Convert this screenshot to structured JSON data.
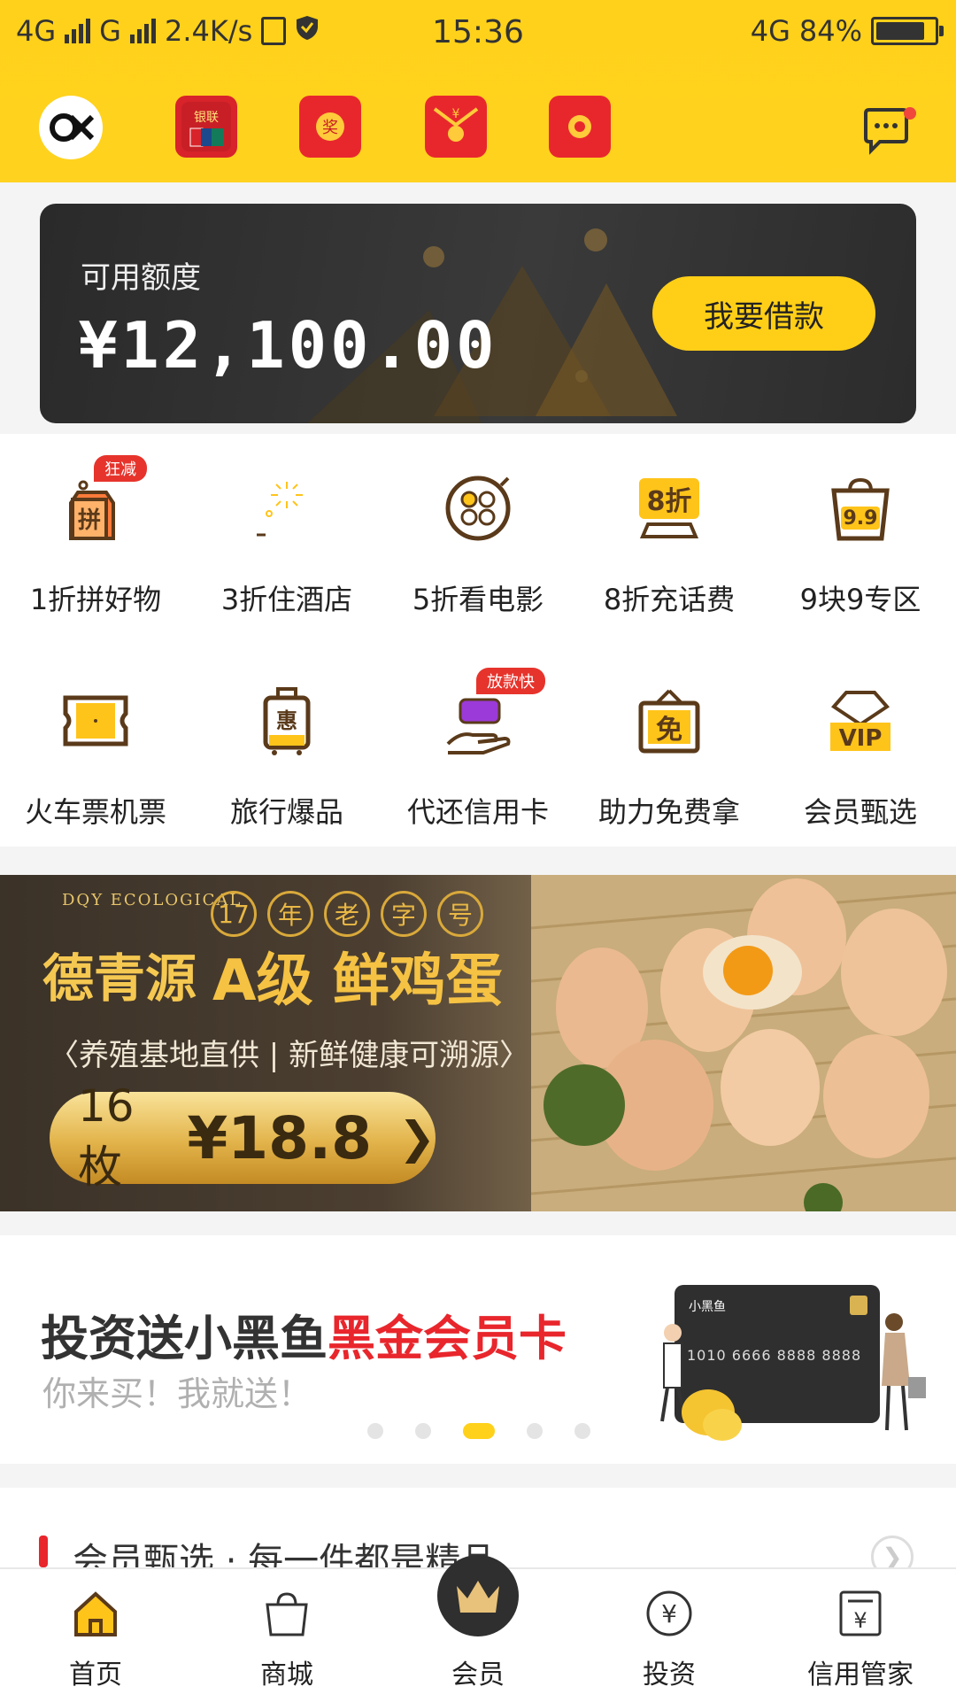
{
  "status_bar": {
    "network_left": "4G",
    "network_g": "G",
    "speed": "2.4K/s",
    "time": "15:36",
    "network_right": "4G",
    "battery": "84%",
    "battery_level": 0.84
  },
  "header": {
    "logo": "fish-logo-icon",
    "quick_icons": [
      "unionpay-icon",
      "prize-redpacket-icon",
      "yuan-redpacket-icon",
      "gift-redpacket-icon"
    ],
    "message_icon": "chat-bubble-icon",
    "has_unread": true
  },
  "credit": {
    "label": "可用额度",
    "amount": "¥12,100.00",
    "button": "我要借款"
  },
  "grid": [
    {
      "label": "1折拼好物",
      "icon": "pin-tag-icon",
      "tag": "狂减"
    },
    {
      "label": "3折住酒店",
      "icon": "hotel-icon",
      "tag": ""
    },
    {
      "label": "5折看电影",
      "icon": "film-reel-icon",
      "tag": ""
    },
    {
      "label": "8折充话费",
      "icon": "phone-discount-icon",
      "tag": ""
    },
    {
      "label": "9块9专区",
      "icon": "shopping-bag-icon",
      "tag": ""
    },
    {
      "label": "火车票机票",
      "icon": "ticket-icon",
      "tag": ""
    },
    {
      "label": "旅行爆品",
      "icon": "suitcase-icon",
      "tag": ""
    },
    {
      "label": "代还信用卡",
      "icon": "card-hand-icon",
      "tag": "放款快"
    },
    {
      "label": "助力免费拿",
      "icon": "free-sign-icon",
      "tag": ""
    },
    {
      "label": "会员甄选",
      "icon": "vip-crown-icon",
      "tag": ""
    }
  ],
  "egg_banner": {
    "brand_en": "DQY ECOLOGICAL",
    "brand": "德青源",
    "slogan": [
      "17",
      "年",
      "老",
      "字",
      "号"
    ],
    "grade": "A级 鲜鸡蛋",
    "sub": "〈养殖基地直供 | 新鲜健康可溯源〉",
    "count": "16枚",
    "price": "¥18.8"
  },
  "promo": {
    "title_black": "投资送小黑鱼",
    "title_red": "黑金会员卡",
    "subtitle": "你来买！我就送！",
    "card_number": "1010 6666 8888 8888",
    "card_brand": "小黑鱼",
    "dots": 5,
    "active_dot": 2
  },
  "section": {
    "title": "会员甄选 · 每一件都是精品"
  },
  "tabs": [
    {
      "label": "首页",
      "icon": "home-icon"
    },
    {
      "label": "商城",
      "icon": "shopping-bag-icon"
    },
    {
      "label": "会员",
      "icon": "crown-icon"
    },
    {
      "label": "投资",
      "icon": "yuan-coin-icon"
    },
    {
      "label": "信用管家",
      "icon": "credit-doc-icon"
    }
  ],
  "colors": {
    "brand_yellow": "#ffd11a",
    "accent_red": "#e8262c",
    "card_dark": "#2f2f2f",
    "icon_brown": "#5a3a1a"
  }
}
